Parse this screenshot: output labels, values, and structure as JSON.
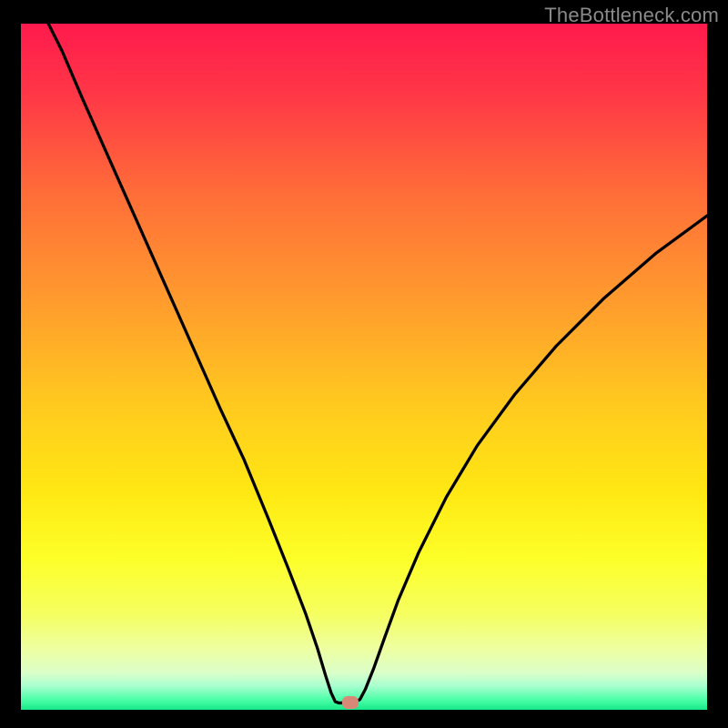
{
  "watermark": "TheBottleneck.com",
  "marker": {
    "x_pct": 48.0,
    "y_pct": 99.0,
    "color": "#d88876"
  },
  "background_gradient": {
    "stops": [
      {
        "offset": 0.0,
        "color": "#ff1a4d"
      },
      {
        "offset": 0.1,
        "color": "#ff3647"
      },
      {
        "offset": 0.25,
        "color": "#ff6e38"
      },
      {
        "offset": 0.4,
        "color": "#ff9a2e"
      },
      {
        "offset": 0.55,
        "color": "#ffc81f"
      },
      {
        "offset": 0.68,
        "color": "#ffe713"
      },
      {
        "offset": 0.78,
        "color": "#fdff28"
      },
      {
        "offset": 0.86,
        "color": "#f5ff60"
      },
      {
        "offset": 0.91,
        "color": "#eeffa0"
      },
      {
        "offset": 0.945,
        "color": "#dcffc8"
      },
      {
        "offset": 0.965,
        "color": "#aaffd0"
      },
      {
        "offset": 0.985,
        "color": "#4dffa8"
      },
      {
        "offset": 1.0,
        "color": "#17e887"
      }
    ]
  },
  "curve": {
    "stroke": "#000000",
    "stroke_width": 3.3,
    "points_pct": [
      [
        4.0,
        0.0
      ],
      [
        6.0,
        4.0
      ],
      [
        9.0,
        11.0
      ],
      [
        13.0,
        20.0
      ],
      [
        17.0,
        29.0
      ],
      [
        21.0,
        38.0
      ],
      [
        25.0,
        47.0
      ],
      [
        29.0,
        56.0
      ],
      [
        32.5,
        63.5
      ],
      [
        36.0,
        72.0
      ],
      [
        39.0,
        79.5
      ],
      [
        41.5,
        86.0
      ],
      [
        43.2,
        91.0
      ],
      [
        44.4,
        95.0
      ],
      [
        45.2,
        97.5
      ],
      [
        45.8,
        98.8
      ],
      [
        46.3,
        99.0
      ],
      [
        48.5,
        99.0
      ],
      [
        49.4,
        98.5
      ],
      [
        50.2,
        97.0
      ],
      [
        51.4,
        94.0
      ],
      [
        53.0,
        89.5
      ],
      [
        55.0,
        84.0
      ],
      [
        58.0,
        77.0
      ],
      [
        62.0,
        69.0
      ],
      [
        66.5,
        61.5
      ],
      [
        72.0,
        54.0
      ],
      [
        78.0,
        47.0
      ],
      [
        85.0,
        40.0
      ],
      [
        92.5,
        33.5
      ],
      [
        100.0,
        28.0
      ]
    ]
  },
  "chart_data": {
    "type": "line",
    "title": "",
    "xlabel": "",
    "ylabel": "",
    "xlim": [
      0,
      100
    ],
    "ylim": [
      0,
      100
    ],
    "series": [
      {
        "name": "bottleneck-curve",
        "x": [
          4.0,
          6.0,
          9.0,
          13.0,
          17.0,
          21.0,
          25.0,
          29.0,
          32.5,
          36.0,
          39.0,
          41.5,
          43.2,
          44.4,
          45.2,
          45.8,
          46.3,
          48.5,
          49.4,
          50.2,
          51.4,
          53.0,
          55.0,
          58.0,
          62.0,
          66.5,
          72.0,
          78.0,
          85.0,
          92.5,
          100.0
        ],
        "y": [
          100.0,
          96.0,
          89.0,
          80.0,
          71.0,
          62.0,
          53.0,
          44.0,
          36.5,
          28.0,
          20.5,
          14.0,
          9.0,
          5.0,
          2.5,
          1.2,
          1.0,
          1.0,
          1.5,
          3.0,
          6.0,
          10.5,
          16.0,
          23.0,
          31.0,
          38.5,
          46.0,
          53.0,
          60.0,
          66.5,
          72.0
        ]
      }
    ],
    "marker_point": {
      "x": 48.0,
      "y": 1.0
    },
    "legend": false,
    "grid": false
  }
}
